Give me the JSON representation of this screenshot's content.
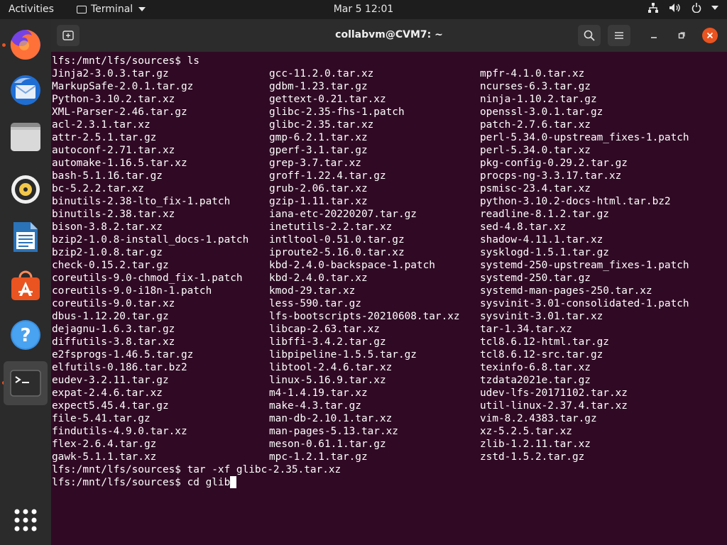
{
  "topbar": {
    "activities": "Activities",
    "app_name": "Terminal",
    "clock": "Mar 5  12:01",
    "icons": [
      "network-icon",
      "volume-icon",
      "power-icon",
      "chevron-down-icon"
    ]
  },
  "dock": {
    "items": [
      {
        "name": "firefox",
        "icon": "firefox-icon",
        "running": true
      },
      {
        "name": "thunderbird",
        "icon": "thunderbird-icon",
        "running": false
      },
      {
        "name": "files",
        "icon": "files-icon",
        "running": false
      },
      {
        "name": "rhythmbox",
        "icon": "rhythmbox-icon",
        "running": false
      },
      {
        "name": "libreoffice-writer",
        "icon": "writer-icon",
        "running": false
      },
      {
        "name": "software",
        "icon": "software-center-icon",
        "running": false
      },
      {
        "name": "help",
        "icon": "help-icon",
        "running": false
      },
      {
        "name": "terminal",
        "icon": "terminal-icon",
        "running": true
      }
    ],
    "show_apps_icon": "app-grid-icon"
  },
  "window": {
    "title": "collabvm@CVM7: ~"
  },
  "terminal": {
    "prompt_ls": "lfs:/mnt/lfs/sources$ ls",
    "col1": [
      "Jinja2-3.0.3.tar.gz",
      "MarkupSafe-2.0.1.tar.gz",
      "Python-3.10.2.tar.xz",
      "XML-Parser-2.46.tar.gz",
      "acl-2.3.1.tar.xz",
      "attr-2.5.1.tar.gz",
      "autoconf-2.71.tar.xz",
      "automake-1.16.5.tar.xz",
      "bash-5.1.16.tar.gz",
      "bc-5.2.2.tar.xz",
      "binutils-2.38-lto_fix-1.patch",
      "binutils-2.38.tar.xz",
      "bison-3.8.2.tar.xz",
      "bzip2-1.0.8-install_docs-1.patch",
      "bzip2-1.0.8.tar.gz",
      "check-0.15.2.tar.gz",
      "coreutils-9.0-chmod_fix-1.patch",
      "coreutils-9.0-i18n-1.patch",
      "coreutils-9.0.tar.xz",
      "dbus-1.12.20.tar.gz",
      "dejagnu-1.6.3.tar.gz",
      "diffutils-3.8.tar.xz",
      "e2fsprogs-1.46.5.tar.gz",
      "elfutils-0.186.tar.bz2",
      "eudev-3.2.11.tar.gz",
      "expat-2.4.6.tar.xz",
      "expect5.45.4.tar.gz",
      "file-5.41.tar.gz",
      "findutils-4.9.0.tar.xz",
      "flex-2.6.4.tar.gz",
      "gawk-5.1.1.tar.xz"
    ],
    "col2": [
      "gcc-11.2.0.tar.xz",
      "gdbm-1.23.tar.gz",
      "gettext-0.21.tar.xz",
      "glibc-2.35-fhs-1.patch",
      "glibc-2.35.tar.xz",
      "gmp-6.2.1.tar.xz",
      "gperf-3.1.tar.gz",
      "grep-3.7.tar.xz",
      "groff-1.22.4.tar.gz",
      "grub-2.06.tar.xz",
      "gzip-1.11.tar.xz",
      "iana-etc-20220207.tar.gz",
      "inetutils-2.2.tar.xz",
      "intltool-0.51.0.tar.gz",
      "iproute2-5.16.0.tar.xz",
      "kbd-2.4.0-backspace-1.patch",
      "kbd-2.4.0.tar.xz",
      "kmod-29.tar.xz",
      "less-590.tar.gz",
      "lfs-bootscripts-20210608.tar.xz",
      "libcap-2.63.tar.xz",
      "libffi-3.4.2.tar.gz",
      "libpipeline-1.5.5.tar.gz",
      "libtool-2.4.6.tar.xz",
      "linux-5.16.9.tar.xz",
      "m4-1.4.19.tar.xz",
      "make-4.3.tar.gz",
      "man-db-2.10.1.tar.xz",
      "man-pages-5.13.tar.xz",
      "meson-0.61.1.tar.gz",
      "mpc-1.2.1.tar.gz"
    ],
    "col3": [
      "mpfr-4.1.0.tar.xz",
      "ncurses-6.3.tar.gz",
      "ninja-1.10.2.tar.gz",
      "openssl-3.0.1.tar.gz",
      "patch-2.7.6.tar.xz",
      "perl-5.34.0-upstream_fixes-1.patch",
      "perl-5.34.0.tar.xz",
      "pkg-config-0.29.2.tar.gz",
      "procps-ng-3.3.17.tar.xz",
      "psmisc-23.4.tar.xz",
      "python-3.10.2-docs-html.tar.bz2",
      "readline-8.1.2.tar.gz",
      "sed-4.8.tar.xz",
      "shadow-4.11.1.tar.xz",
      "sysklogd-1.5.1.tar.gz",
      "systemd-250-upstream_fixes-1.patch",
      "systemd-250.tar.gz",
      "systemd-man-pages-250.tar.xz",
      "sysvinit-3.01-consolidated-1.patch",
      "sysvinit-3.01.tar.xz",
      "tar-1.34.tar.xz",
      "tcl8.6.12-html.tar.gz",
      "tcl8.6.12-src.tar.gz",
      "texinfo-6.8.tar.xz",
      "tzdata2021e.tar.gz",
      "udev-lfs-20171102.tar.xz",
      "util-linux-2.37.4.tar.xz",
      "vim-8.2.4383.tar.gz",
      "xz-5.2.5.tar.xz",
      "zlib-1.2.11.tar.xz",
      "zstd-1.5.2.tar.gz"
    ],
    "prompt_tar": "lfs:/mnt/lfs/sources$ tar -xf glibc-2.35.tar.xz",
    "prompt_cd": "lfs:/mnt/lfs/sources$ cd glib"
  }
}
